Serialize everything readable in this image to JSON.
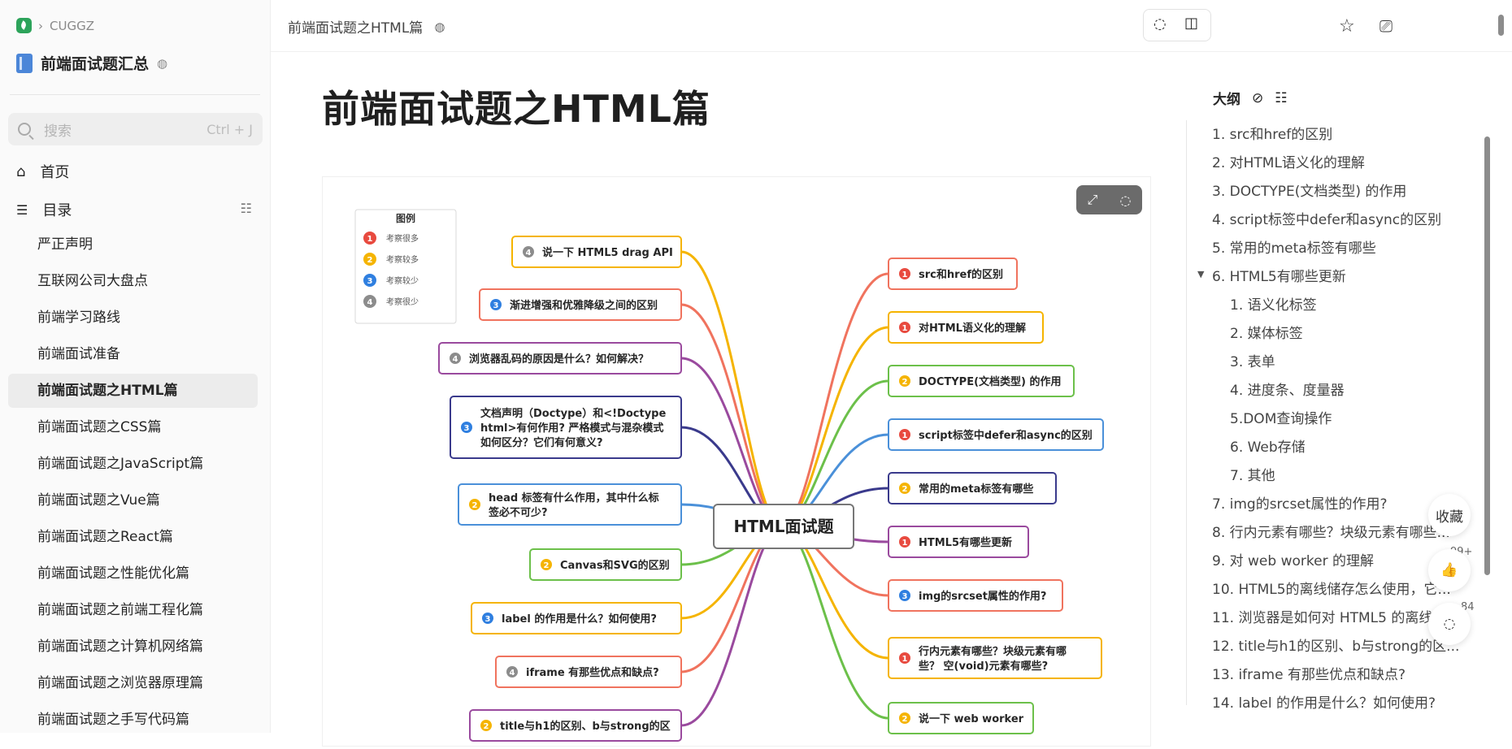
{
  "breadcrumb": {
    "org": "CUGGZ"
  },
  "knowledge_base": {
    "title": "前端面试题汇总"
  },
  "search": {
    "placeholder": "搜索",
    "shortcut": "Ctrl + J"
  },
  "nav": {
    "home": "首页",
    "catalog": "目录"
  },
  "toc": [
    "严正声明",
    "互联网公司大盘点",
    "前端学习路线",
    "前端面试准备",
    "前端面试题之HTML篇",
    "前端面试题之CSS篇",
    "前端面试题之JavaScript篇",
    "前端面试题之Vue篇",
    "前端面试题之React篇",
    "前端面试题之性能优化篇",
    "前端面试题之前端工程化篇",
    "前端面试题之计算机网络篇",
    "前端面试题之浏览器原理篇",
    "前端面试题之手写代码篇"
  ],
  "header": {
    "doc_crumb": "前端面试题之HTML篇"
  },
  "doc": {
    "title": "前端面试题之HTML篇"
  },
  "mindmap": {
    "center": "HTML面试题",
    "legend": {
      "title": "图例",
      "items": [
        {
          "num": "1",
          "label": "考察很多",
          "color": "#e84a3f"
        },
        {
          "num": "2",
          "label": "考察较多",
          "color": "#f5b400"
        },
        {
          "num": "3",
          "label": "考察较少",
          "color": "#2f7fe0"
        },
        {
          "num": "4",
          "label": "考察很少",
          "color": "#8c8c8c"
        }
      ]
    },
    "left": [
      {
        "num": "4",
        "lines": [
          "说一下 HTML5 drag API"
        ],
        "color": "#f5b400"
      },
      {
        "num": "3",
        "lines": [
          "渐进增强和优雅降级之间的区别"
        ],
        "color": "#f0735e"
      },
      {
        "num": "4",
        "lines": [
          "浏览器乱码的原因是什么？如何解决？"
        ],
        "color": "#9a4a9e"
      },
      {
        "num": "3",
        "lines": [
          "文档声明（Doctype）和<!Doctype",
          "html>有何作用? 严格模式与混杂模式",
          "如何区分？它们有何意义?"
        ],
        "color": "#3a3a8c"
      },
      {
        "num": "2",
        "lines": [
          "head 标签有什么作用，其中什么标",
          "签必不可少?"
        ],
        "color": "#4a90d9"
      },
      {
        "num": "2",
        "lines": [
          "Canvas和SVG的区别"
        ],
        "color": "#6cc04a"
      },
      {
        "num": "3",
        "lines": [
          "label 的作用是什么？如何使用?"
        ],
        "color": "#f5b400"
      },
      {
        "num": "4",
        "lines": [
          "iframe 有那些优点和缺点?"
        ],
        "color": "#f0735e"
      },
      {
        "num": "2",
        "lines": [
          "title与h1的区别、b与strong的区"
        ],
        "color": "#9a4a9e"
      }
    ],
    "right": [
      {
        "num": "1",
        "lines": [
          "src和href的区别"
        ],
        "color": "#f0735e"
      },
      {
        "num": "1",
        "lines": [
          "对HTML语义化的理解"
        ],
        "color": "#f5b400"
      },
      {
        "num": "2",
        "lines": [
          "DOCTYPE(文档类型) 的作用"
        ],
        "color": "#6cc04a"
      },
      {
        "num": "1",
        "lines": [
          "script标签中defer和async的区别"
        ],
        "color": "#4a90d9"
      },
      {
        "num": "2",
        "lines": [
          "常用的meta标签有哪些"
        ],
        "color": "#3a3a8c"
      },
      {
        "num": "1",
        "lines": [
          "HTML5有哪些更新"
        ],
        "color": "#9a4a9e"
      },
      {
        "num": "3",
        "lines": [
          "img的srcset属性的作用?"
        ],
        "color": "#f0735e"
      },
      {
        "num": "1",
        "lines": [
          "行内元素有哪些？块级元素有哪",
          "些？ 空(void)元素有哪些?"
        ],
        "color": "#f5b400"
      },
      {
        "num": "2",
        "lines": [
          "说一下 web worker"
        ],
        "color": "#6cc04a"
      }
    ]
  },
  "outline": {
    "title": "大纲",
    "items": [
      {
        "text": "1. src和href的区别",
        "level": 1
      },
      {
        "text": "2. 对HTML语义化的理解",
        "level": 1
      },
      {
        "text": "3. DOCTYPE(文档类型) 的作用",
        "level": 1
      },
      {
        "text": "4. script标签中defer和async的区别",
        "level": 1
      },
      {
        "text": "5. 常用的meta标签有哪些",
        "level": 1
      },
      {
        "text": "6. HTML5有哪些更新",
        "level": 1
      },
      {
        "text": "1. 语义化标签",
        "level": 2
      },
      {
        "text": "2. 媒体标签",
        "level": 2
      },
      {
        "text": "3. 表单",
        "level": 2
      },
      {
        "text": "4. 进度条、度量器",
        "level": 2
      },
      {
        "text": "5.DOM查询操作",
        "level": 2
      },
      {
        "text": "6. Web存储",
        "level": 2
      },
      {
        "text": "7. 其他",
        "level": 2
      },
      {
        "text": "7. img的srcset属性的作用?",
        "level": 1
      },
      {
        "text": "8. 行内元素有哪些？块级元素有哪些...",
        "level": 1
      },
      {
        "text": "9. 对 web worker 的理解",
        "level": 1
      },
      {
        "text": "10. HTML5的离线储存怎么使用，它...",
        "level": 1
      },
      {
        "text": "11. 浏览器是如何对 HTML5 的离线储...",
        "level": 1
      },
      {
        "text": "12. title与h1的区别、b与strong的区...",
        "level": 1
      },
      {
        "text": "13. iframe 有那些优点和缺点?",
        "level": 1
      },
      {
        "text": "14. label 的作用是什么？如何使用?",
        "level": 1
      }
    ]
  },
  "floating": {
    "collect": "收藏",
    "likes": "99+",
    "comments": "84"
  }
}
